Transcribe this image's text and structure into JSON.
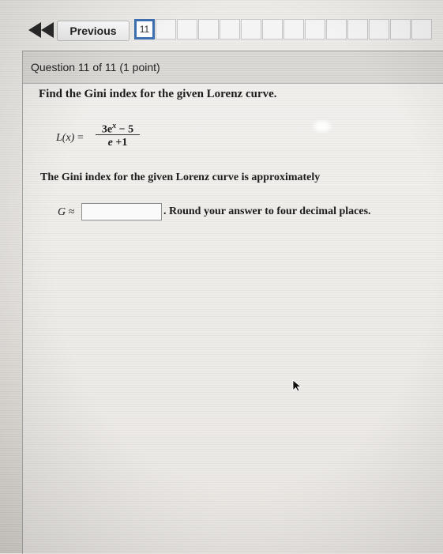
{
  "nav": {
    "back_icon": "double-left-arrow-icon",
    "previous_label": "Previous",
    "question_numbers": [
      "11",
      "",
      "",
      "",
      "",
      "",
      "",
      "",
      "",
      "",
      "",
      "",
      "",
      ""
    ],
    "current_index": 0
  },
  "question": {
    "info": "Question 11 of 11 (1 point)",
    "prompt": "Find the Gini index for the given Lorenz curve.",
    "formula": {
      "lhs": "L(x)",
      "equals": "=",
      "numerator_coeff": "3e",
      "numerator_exp": "x",
      "numerator_tail": " − 5",
      "denominator_base": "e",
      "denominator_tail": " +1"
    },
    "statement": "The Gini index for the given Lorenz curve is approximately",
    "answer_label": "G ≈",
    "answer_value": "",
    "round_note": ". Round your answer to four decimal places."
  },
  "colors": {
    "accent_border": "#3d6fb0",
    "background": "#ebe8e4"
  }
}
